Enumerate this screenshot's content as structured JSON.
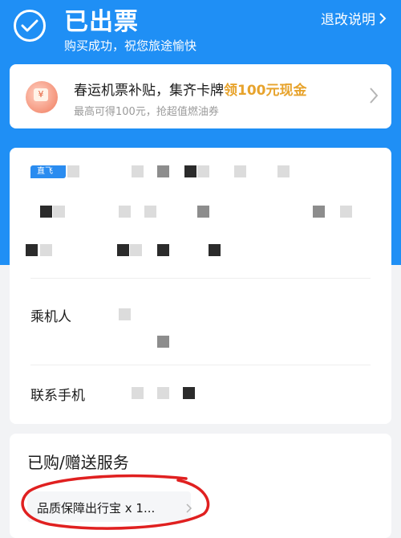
{
  "header": {
    "status_title": "已出票",
    "status_subtitle": "购买成功，祝您旅途愉快",
    "refund_link": "退改说明",
    "check_icon": "check-circle-icon"
  },
  "promo": {
    "title_prefix": "春运机票补贴，集齐卡牌",
    "title_highlight": "领100元现金",
    "subtitle": "最高可得100元，抢超值燃油券",
    "icon": "red-envelope-icon",
    "highlight_color": "#e7a32c"
  },
  "flight": {
    "badge": "直飞",
    "passenger_label": "乘机人",
    "contact_label": "联系手机"
  },
  "services": {
    "title": "已购/赠送服务",
    "item": "品质保障出行宝 x 1..."
  },
  "colors": {
    "brand_blue": "#1f8ff5",
    "annotation_red": "#e02020"
  }
}
